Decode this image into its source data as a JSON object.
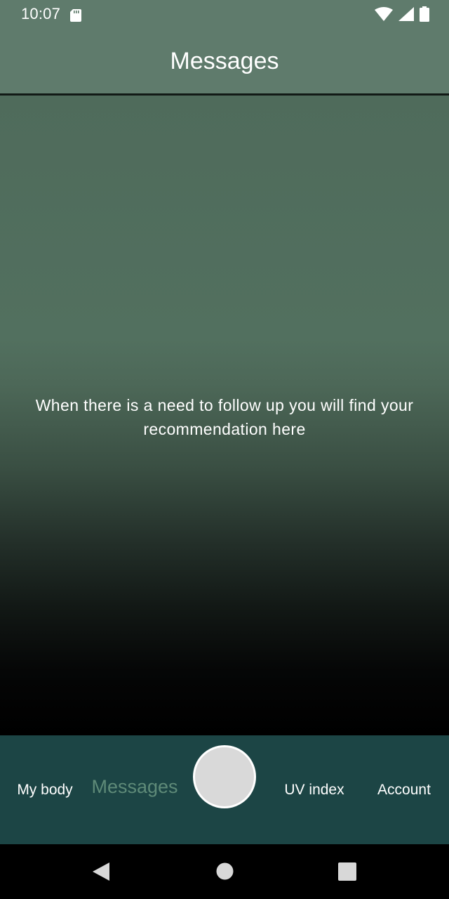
{
  "status_bar": {
    "time": "10:07",
    "icons": [
      "sd-card-icon",
      "wifi-icon",
      "cellular-signal-icon",
      "battery-icon"
    ]
  },
  "app_bar": {
    "title": "Messages"
  },
  "content": {
    "empty_message": "When there is a need to follow up you will find your recommendation here"
  },
  "bottom_nav": {
    "items": [
      {
        "label": "My body",
        "active": false
      },
      {
        "label": "Messages",
        "active": true
      },
      {
        "label": "UV index",
        "active": false
      },
      {
        "label": "Account",
        "active": false
      }
    ],
    "center_button": "scan-button"
  },
  "system_nav": {
    "buttons": [
      "back-icon",
      "home-icon",
      "recents-icon"
    ]
  },
  "colors": {
    "header_bg": "#5f7b6c",
    "nav_bg": "#1c4545",
    "active_nav_text": "#5e8a78",
    "center_button": "#d9d9d9"
  }
}
